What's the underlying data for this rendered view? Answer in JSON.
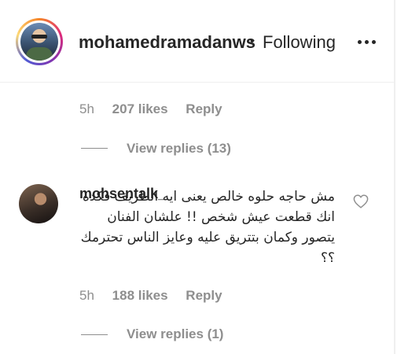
{
  "header": {
    "username": "mohamedramadanws",
    "separator": "•",
    "follow_status": "Following"
  },
  "comment_prev": {
    "time": "5h",
    "likes": "207 likes",
    "reply": "Reply",
    "view_replies": "View replies (13)"
  },
  "comment": {
    "username": "mohsentalk_",
    "text": "مش حاجه حلوه خالص يعنى ايه الظريف فكده انك قطعت عيش شخص !! علشان الفنان يتصور وكمان بتتريق عليه وعايز الناس تحترمك ؟؟",
    "time": "5h",
    "likes": "188 likes",
    "reply": "Reply",
    "view_replies": "View replies (1)"
  },
  "icons": {
    "more": "more-horizontal-icon",
    "heart": "heart-outline-icon"
  }
}
